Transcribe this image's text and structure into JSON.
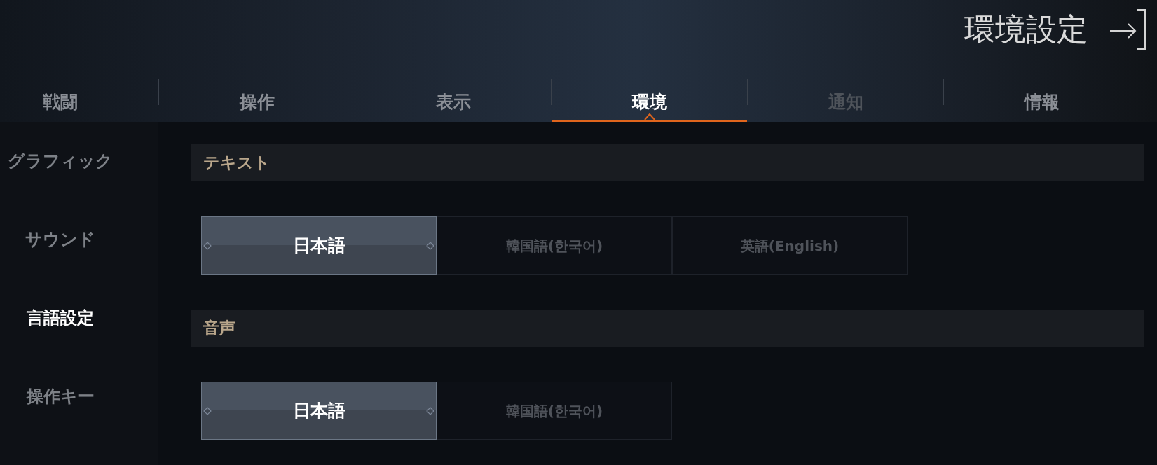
{
  "header": {
    "title": "環境設定"
  },
  "tabs": [
    {
      "label": "戦闘",
      "selected": false,
      "disabled": false
    },
    {
      "label": "操作",
      "selected": false,
      "disabled": false
    },
    {
      "label": "表示",
      "selected": false,
      "disabled": false
    },
    {
      "label": "環境",
      "selected": true,
      "disabled": false
    },
    {
      "label": "通知",
      "selected": false,
      "disabled": true
    },
    {
      "label": "情報",
      "selected": false,
      "disabled": false
    }
  ],
  "sidebar": {
    "items": [
      {
        "label": "グラフィック",
        "selected": false
      },
      {
        "label": "サウンド",
        "selected": false
      },
      {
        "label": "言語設定",
        "selected": true
      },
      {
        "label": "操作キー",
        "selected": false
      }
    ]
  },
  "sections": [
    {
      "title": "テキスト",
      "options": [
        {
          "label": "日本語",
          "selected": true
        },
        {
          "label": "韓国語(한국어)",
          "selected": false
        },
        {
          "label": "英語(English)",
          "selected": false
        }
      ]
    },
    {
      "title": "音声",
      "options": [
        {
          "label": "日本語",
          "selected": true
        },
        {
          "label": "韓国語(한국어)",
          "selected": false
        }
      ]
    }
  ]
}
